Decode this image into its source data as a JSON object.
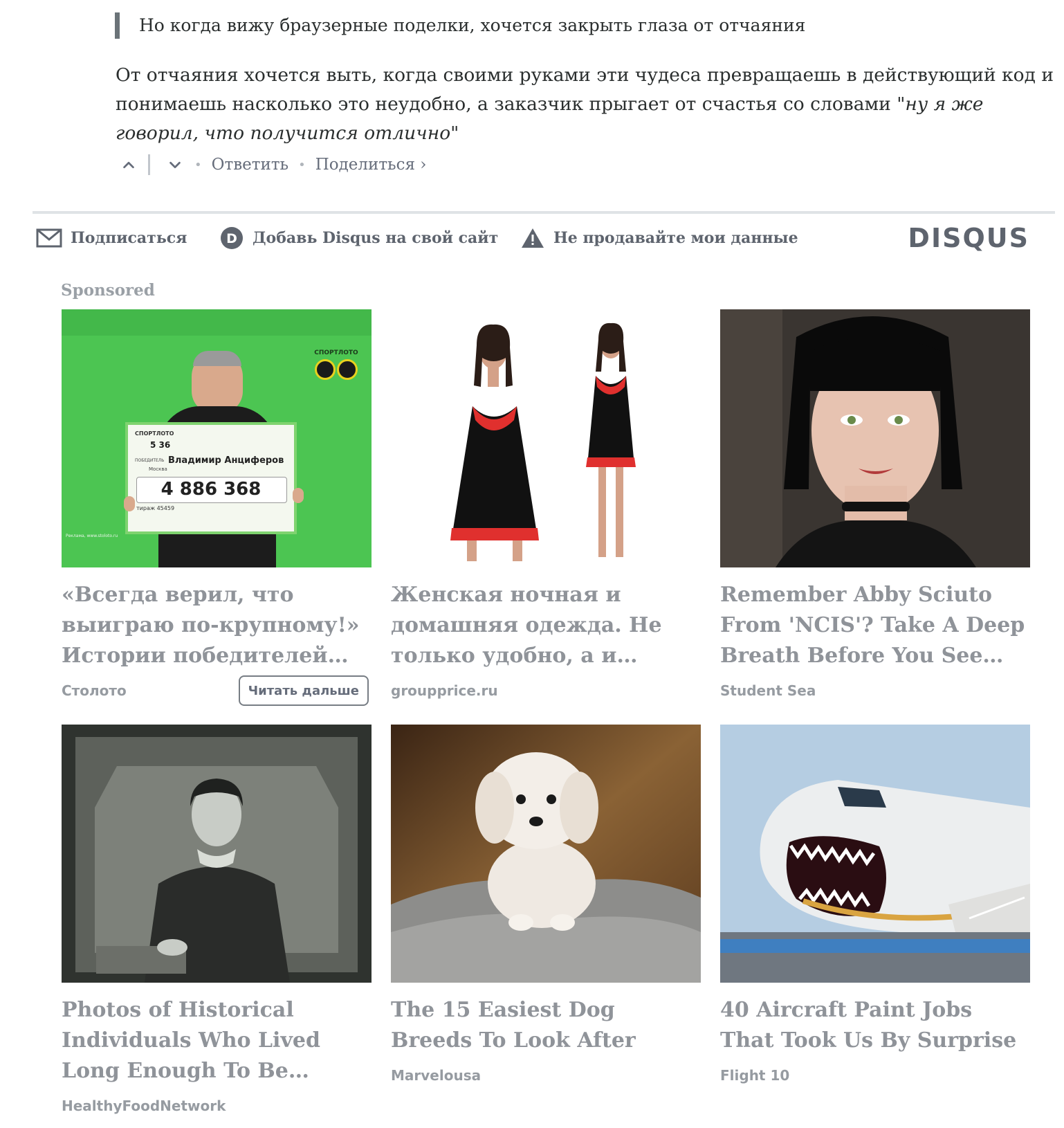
{
  "comment": {
    "quote": "Но когда вижу браузерные поделки, хочется закрыть глаза от отчаяния",
    "body_plain": "От отчаяния хочется выть, когда своими руками эти чудеса превращаешь в действующий код и понимаешь насколько это неудобно, а заказчик прыгает от счастья со словами ",
    "body_italic": "\"ну я же говорил, что получится отлично\"",
    "reply_label": "Ответить",
    "share_label": "Поделиться ›"
  },
  "footer": {
    "subscribe": "Подписаться",
    "add_disqus": "Добавь Disqus на свой сайт",
    "do_not_sell": "Не продавайте мои данные",
    "logo": "DISQUS"
  },
  "sponsored": {
    "label": "Sponsored",
    "read_more": "Читать дальше",
    "cards": [
      {
        "title": "«Всегда верил, что выиграю по-крупному!» Истории победителей…",
        "source": "Столото"
      },
      {
        "title": "Женская ночная и домашняя одежда. Не только удобно, а и…",
        "source": "groupprice.ru"
      },
      {
        "title": "Remember Abby Sciuto From 'NCIS'? Take A Deep Breath Before You See…",
        "source": "Student Sea"
      },
      {
        "title": "Photos of Historical Individuals Who Lived Long Enough To Be…",
        "source": "HealthyFoodNetwork"
      },
      {
        "title": "The 15 Easiest Dog Breeds To Look After",
        "source": "Marvelousa"
      },
      {
        "title": "40 Aircraft Paint Jobs That Took Us By Surprise",
        "source": "Flight 10"
      }
    ]
  },
  "lottery_ad": {
    "brand": "СПОРТЛОТО",
    "game": "5 36",
    "winner_label": "ПОБЕДИТЕЛЬ",
    "winner_name": "Владимир Анциферов",
    "city": "Москва",
    "amount": "4 886 368",
    "draw": "тираж 45459",
    "disclaimer": "Реклама, www.stoloto.ru"
  },
  "colors": {
    "text": "#2a2e2e",
    "muted": "#656c7a",
    "card_title": "#8f9399",
    "lottery_green": "#4cc552"
  }
}
